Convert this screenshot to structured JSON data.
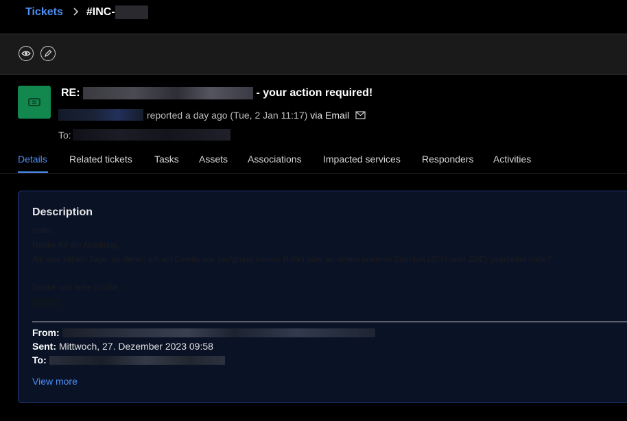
{
  "breadcrumb": {
    "parent": "Tickets",
    "separator": ">",
    "current_prefix": "#INC-"
  },
  "toolbar": {
    "view_icon": "eye-icon",
    "edit_icon": "pencil-icon"
  },
  "ticket": {
    "icon": "ticket-icon",
    "icon_color": "#12884f",
    "subject_prefix": "RE: ",
    "subject_suffix": " - your action required!",
    "reported_text": "reported a day ago (Tue, 2 Jan 11:17)",
    "via_text": "via Email",
    "via_icon": "envelope-icon",
    "to_label": "To:"
  },
  "tabs": [
    {
      "label": "Details",
      "active": true
    },
    {
      "label": "Related tickets"
    },
    {
      "label": "Tasks"
    },
    {
      "label": "Assets"
    },
    {
      "label": "Associations"
    },
    {
      "label": "Impacted services"
    },
    {
      "label": "Responders"
    },
    {
      "label": "Activities"
    }
  ],
  "description": {
    "title": "Description",
    "lines": [
      "Hallo,",
      "Danke für die Anleitung.",
      "Als was zählen Tage, an denen ich auf Events war (aufgrund meiner Rolle) oder an einem anderen Standort (ZCH oder ZDE) gearbeitat habe?",
      "Danke und liebe Grüße,"
    ],
    "from_label": "From:",
    "sent_label": "Sent:",
    "sent_value": "Mittwoch, 27. Dezember 2023 09:58",
    "to_label": "To:",
    "view_more": "View more"
  },
  "colors": {
    "accent": "#4d8ff5",
    "card_border": "#1f3a78",
    "card_bg": "#0a1226"
  }
}
